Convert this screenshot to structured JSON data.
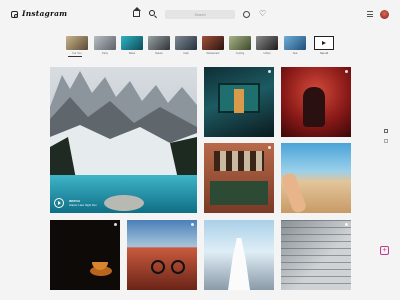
{
  "app": {
    "brand": "Instagram"
  },
  "search": {
    "placeholder": "Search"
  },
  "categories": [
    {
      "label": "For You",
      "color": "#7a6a55"
    },
    {
      "label": "Party",
      "color": "#8a8f96"
    },
    {
      "label": "Wave",
      "color": "#2c8a96"
    },
    {
      "label": "Nature",
      "color": "#6d7478"
    },
    {
      "label": "Cafe",
      "color": "#5a6470"
    },
    {
      "label": "Restaurant",
      "color": "#6b3a2e"
    },
    {
      "label": "Cycling",
      "color": "#6f7a5a"
    },
    {
      "label": "Urban",
      "color": "#4a4a4a"
    },
    {
      "label": "Sea",
      "color": "#3a78a8"
    }
  ],
  "see_all": {
    "label": "See all"
  },
  "feed": {
    "video_title": "WATCH",
    "video_subtitle": "Glacier Lake Night Run"
  },
  "fab": {
    "glyph": "+"
  }
}
